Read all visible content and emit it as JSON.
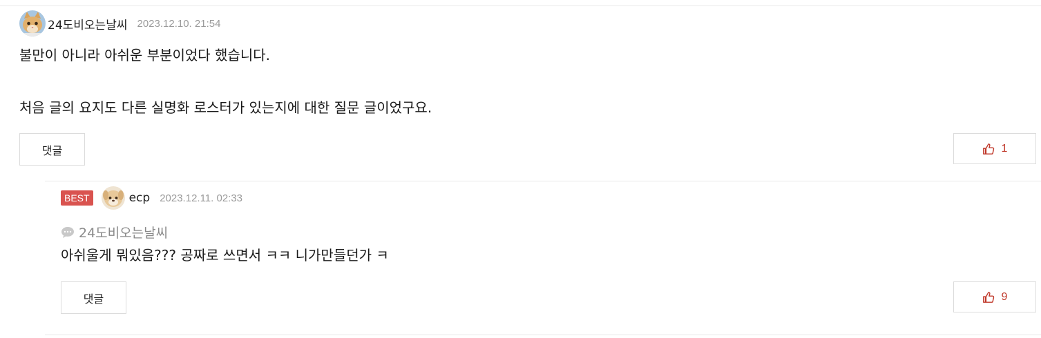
{
  "comments": [
    {
      "author": "24도비오는날씨",
      "date": "2023.12.10. 21:54",
      "avatar_icon": "cat-avatar-icon",
      "text": "불만이 아니라 아쉬운 부분이었다 했습니다.\n\n처음 글의 요지도 다른 실명화 로스터가 있는지에 대한 질문 글이었구요.",
      "reply_label": "댓글",
      "likes": "1"
    },
    {
      "badge": "BEST",
      "author": "ecp",
      "date": "2023.12.11. 02:33",
      "avatar_icon": "puppy-avatar-icon",
      "quoted_author": "24도비오는날씨",
      "text": "아쉬울게 뭐있음??? 공짜로 쓰면서 ㅋㅋ 니가만들던가 ㅋ",
      "reply_label": "댓글",
      "likes": "9"
    }
  ],
  "colors": {
    "like": "#c0392b",
    "best_badge": "#d9534f",
    "muted": "#9a9a9a"
  }
}
